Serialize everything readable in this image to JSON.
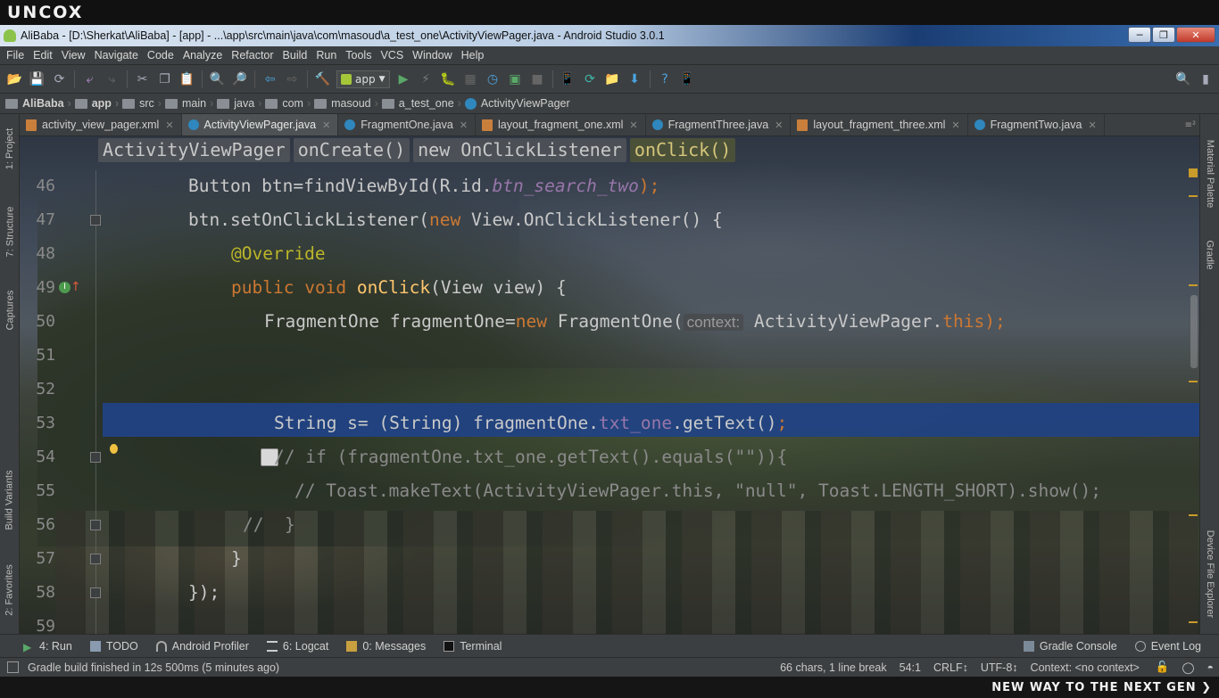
{
  "desktop": {
    "logo_text": "UNCOX",
    "footer_slogan": "NEW WAY TO THE NEXT GEN ❯"
  },
  "window": {
    "title": "AliBaba - [D:\\Sherkat\\AliBaba] - [app] - ...\\app\\src\\main\\java\\com\\masoud\\a_test_one\\ActivityViewPager.java - Android Studio 3.0.1"
  },
  "menu": [
    "File",
    "Edit",
    "View",
    "Navigate",
    "Code",
    "Analyze",
    "Refactor",
    "Build",
    "Run",
    "Tools",
    "VCS",
    "Window",
    "Help"
  ],
  "toolbar": {
    "run_config": "app"
  },
  "breadcrumbs": [
    "AliBaba",
    "app",
    "src",
    "main",
    "java",
    "com",
    "masoud",
    "a_test_one",
    "ActivityViewPager"
  ],
  "editor_tabs": [
    {
      "label": "activity_view_pager.xml",
      "kind": "xml",
      "active": false
    },
    {
      "label": "ActivityViewPager.java",
      "kind": "java",
      "active": true
    },
    {
      "label": "FragmentOne.java",
      "kind": "java",
      "active": false
    },
    {
      "label": "layout_fragment_one.xml",
      "kind": "xml",
      "active": false
    },
    {
      "label": "FragmentThree.java",
      "kind": "java",
      "active": false
    },
    {
      "label": "layout_fragment_three.xml",
      "kind": "xml",
      "active": false
    },
    {
      "label": "FragmentTwo.java",
      "kind": "java",
      "active": false
    }
  ],
  "tabs_count": "≡²",
  "editor_breadcrumb": [
    "ActivityViewPager",
    "onCreate()",
    "new OnClickListener",
    "onClick()"
  ],
  "code": {
    "l46": {
      "num": "46",
      "a": "Button btn=findViewById(R.id.",
      "b": "btn_search_two",
      "c": ");"
    },
    "l47": {
      "num": "47",
      "a": "btn.setOnClickListener(",
      "kw": "new",
      "b": " View.OnClickListener() {"
    },
    "l48": {
      "num": "48",
      "a": "@Override"
    },
    "l49": {
      "num": "49",
      "kw1": "public",
      "kw2": "void",
      "fn": "onClick",
      "b": "(View view) {"
    },
    "l50": {
      "num": "50",
      "a": "FragmentOne fragmentOne=",
      "kw": "new",
      "b": " FragmentOne(",
      "hint": "context:",
      "c": " ActivityViewPager.",
      "kw2": "this",
      "d": ");"
    },
    "l51": {
      "num": "51"
    },
    "l52": {
      "num": "52"
    },
    "l53": {
      "num": "53",
      "a": "String s= (String) fragmentOne.",
      "fld": "txt_one",
      "b": ".getText()",
      "c": ";"
    },
    "l54": {
      "num": "54",
      "a": "// if (fragmentOne.txt_one.getText().equals(\"\")){"
    },
    "l55": {
      "num": "55",
      "a": "// Toast.makeText(ActivityViewPager.this, \"null\", Toast.LENGTH_SHORT).show();"
    },
    "l56": {
      "num": "56",
      "a": "//  }"
    },
    "l57": {
      "num": "57",
      "a": "}"
    },
    "l58": {
      "num": "58",
      "a": "});"
    },
    "l59": {
      "num": "59"
    }
  },
  "left_tool_tabs": [
    "1: Project",
    "7: Structure",
    "Captures",
    "Build Variants",
    "2: Favorites"
  ],
  "right_tool_tabs": [
    "Material Palette",
    "Gradle",
    "Device File Explorer"
  ],
  "bottom_tools": {
    "run": "4: Run",
    "todo": "TODO",
    "profiler": "Android Profiler",
    "logcat": "6: Logcat",
    "messages": "0: Messages",
    "terminal": "Terminal",
    "gradle_console": "Gradle Console",
    "event_log": "Event Log"
  },
  "status": {
    "message": "Gradle build finished in 12s 500ms (5 minutes ago)",
    "selection": "66 chars, 1 line break",
    "position": "54:1",
    "line_sep": "CRLF↕",
    "encoding": "UTF-8↕",
    "context": "Context: <no context>"
  },
  "colors": {
    "keyword": "#cc7832",
    "field": "#9876aa",
    "method": "#ffc66d",
    "annotation": "#bbb529",
    "selection": "#214283"
  }
}
